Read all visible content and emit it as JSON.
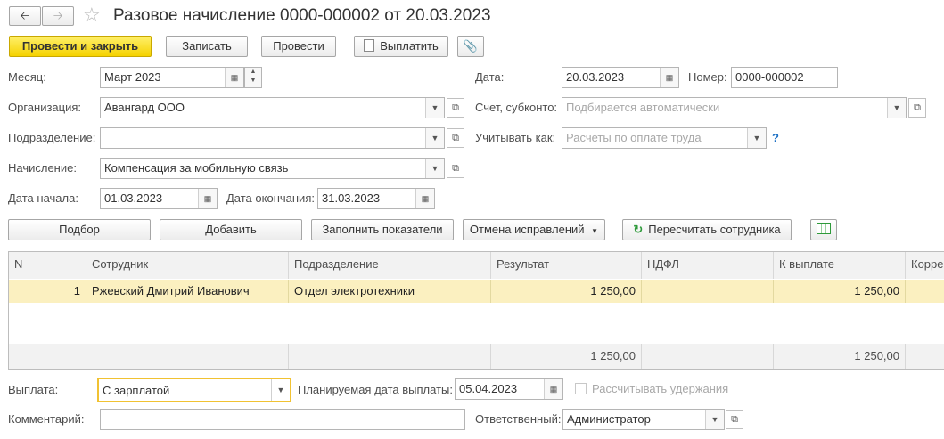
{
  "window": {
    "title": "Разовое начисление 0000-000002 от 20.03.2023"
  },
  "toolbar": {
    "post_close": "Провести и закрыть",
    "write": "Записать",
    "post": "Провести",
    "pay": "Выплатить"
  },
  "form": {
    "month_label": "Месяц:",
    "month_value": "Март 2023",
    "date_label": "Дата:",
    "date_value": "20.03.2023",
    "number_label": "Номер:",
    "number_value": "0000-000002",
    "org_label": "Организация:",
    "org_value": "Авангард ООО",
    "account_label": "Счет, субконто:",
    "account_placeholder": "Подбирается автоматически",
    "dept_label": "Подразделение:",
    "dept_value": "",
    "consider_label": "Учитывать как:",
    "consider_placeholder": "Расчеты по оплате труда",
    "help": "?",
    "accrual_label": "Начисление:",
    "accrual_value": "Компенсация за мобильную связь",
    "start_label": "Дата начала:",
    "start_value": "01.03.2023",
    "end_label": "Дата окончания:",
    "end_value": "31.03.2023"
  },
  "table_toolbar": {
    "select": "Подбор",
    "add": "Добавить",
    "fill": "Заполнить показатели",
    "cancel_fix": "Отмена исправлений",
    "recalc": "Пересчитать сотрудника"
  },
  "grid": {
    "columns": [
      "N",
      "Сотрудник",
      "Подразделение",
      "Результат",
      "НДФЛ",
      "К выплате",
      "Корре"
    ],
    "rows": [
      {
        "n": "1",
        "employee": "Ржевский Дмитрий Иванович",
        "dept": "Отдел электротехники",
        "result": "1 250,00",
        "ndfl": "",
        "payout": "1 250,00",
        "corr": ""
      }
    ],
    "totals": {
      "result": "1 250,00",
      "payout": "1 250,00"
    }
  },
  "footer": {
    "payment_label": "Выплата:",
    "payment_value": "С зарплатой",
    "planned_label": "Планируемая дата выплаты:",
    "planned_value": "05.04.2023",
    "withholding_label": "Рассчитывать удержания",
    "comment_label": "Комментарий:",
    "comment_value": "",
    "responsible_label": "Ответственный:",
    "responsible_value": "Администратор"
  },
  "colors": {
    "primary": "#f5d200",
    "selected_row": "#fbf0c0",
    "link_blue": "#1a6fc4",
    "green_icon": "#2e9a3a"
  }
}
